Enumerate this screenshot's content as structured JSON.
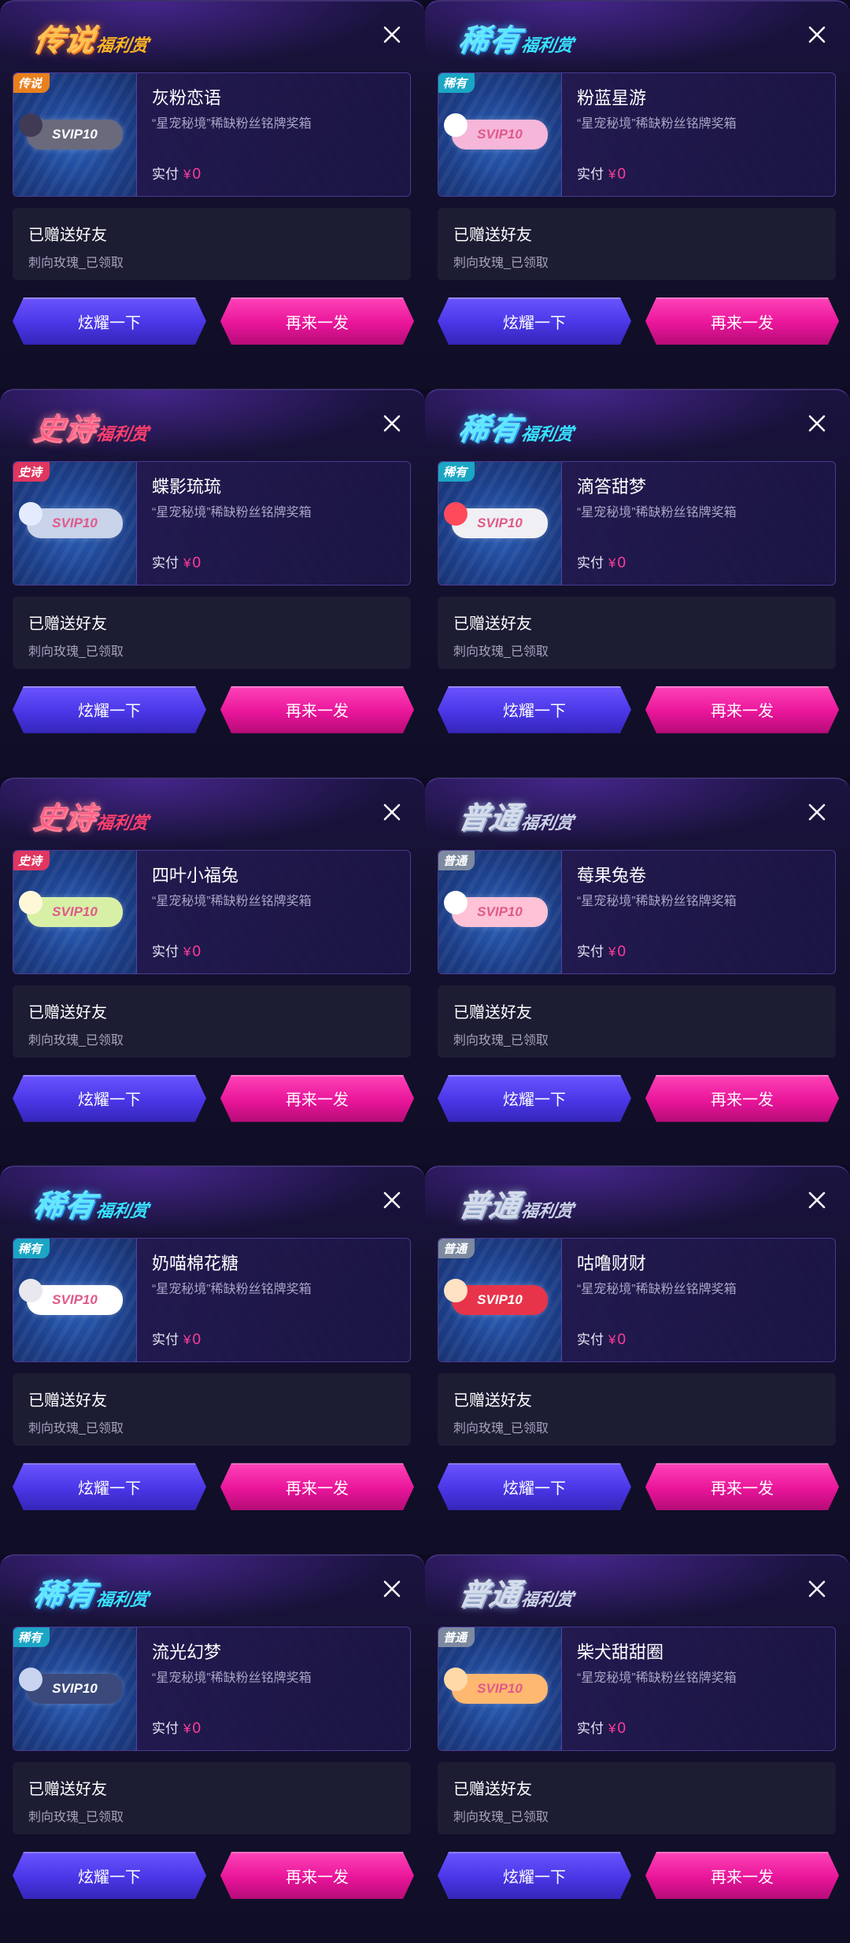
{
  "ui": {
    "gift_title": "已赠送好友",
    "gift_status": "刺向玫瑰_已领取",
    "paid_label": "实付",
    "currency": "¥",
    "amount": "0",
    "show_button": "炫耀一下",
    "again_button": "再来一发",
    "title_suffix": "福利赏",
    "badge_text": "SVIP10"
  },
  "tiers": {
    "legend": {
      "label": "传说",
      "color": "#ffb321",
      "color2": "#ff7a1a",
      "tag_bg": "#e8801d"
    },
    "epic": {
      "label": "史诗",
      "color": "#ff3f6c",
      "color2": "#ff7a8c",
      "tag_bg": "#e0365f"
    },
    "rare": {
      "label": "稀有",
      "color": "#36e2ff",
      "color2": "#2aa8ff",
      "tag_bg": "#1ba6c4"
    },
    "common": {
      "label": "普通",
      "color": "#c9d2e6",
      "color2": "#8fa3c8",
      "tag_bg": "#7d8aa0"
    }
  },
  "cards": [
    {
      "tier": "legend",
      "name": "灰粉恋语",
      "desc": "“星宠秘境”稀缺粉丝铭牌奖箱",
      "badge_bg": "#6b6a7d",
      "mascot": "#403a55"
    },
    {
      "tier": "rare",
      "name": "粉蓝星游",
      "desc": "“星宠秘境”稀缺粉丝铭牌奖箱",
      "badge_bg": "#f6b6da",
      "mascot": "#ffffff"
    },
    {
      "tier": "epic",
      "name": "蝶影琉琉",
      "desc": "“星宠秘境”稀缺粉丝铭牌奖箱",
      "badge_bg": "#c9d3ea",
      "mascot": "#e4ebff"
    },
    {
      "tier": "rare",
      "name": "滴答甜梦",
      "desc": "“星宠秘境”稀缺粉丝铭牌奖箱",
      "badge_bg": "#f0f0f4",
      "mascot": "#ff4a5c"
    },
    {
      "tier": "epic",
      "name": "四叶小福兔",
      "desc": "“星宠秘境”稀缺粉丝铭牌奖箱",
      "badge_bg": "#d8f0a6",
      "mascot": "#fff8d8"
    },
    {
      "tier": "common",
      "name": "莓果兔卷",
      "desc": "“星宠秘境”稀缺粉丝铭牌奖箱",
      "badge_bg": "#ffc2d6",
      "mascot": "#ffffff"
    },
    {
      "tier": "rare",
      "name": "奶喵棉花糖",
      "desc": "“星宠秘境”稀缺粉丝铭牌奖箱",
      "badge_bg": "#ffffff",
      "mascot": "#e8e8ee"
    },
    {
      "tier": "common",
      "name": "咕噜财财",
      "desc": "“星宠秘境”稀缺粉丝铭牌奖箱",
      "badge_bg": "#e8344a",
      "mascot": "#ffe1c4"
    },
    {
      "tier": "rare",
      "name": "流光幻梦",
      "desc": "“星宠秘境”稀缺粉丝铭牌奖箱",
      "badge_bg": "#3b4a7a",
      "mascot": "#c8d4f0"
    },
    {
      "tier": "common",
      "name": "柴犬甜甜圈",
      "desc": "“星宠秘境”稀缺粉丝铭牌奖箱",
      "badge_bg": "#ffb870",
      "mascot": "#ffd9a8"
    }
  ],
  "icons": {
    "close": "close-icon",
    "mascot": "mascot-icon"
  }
}
